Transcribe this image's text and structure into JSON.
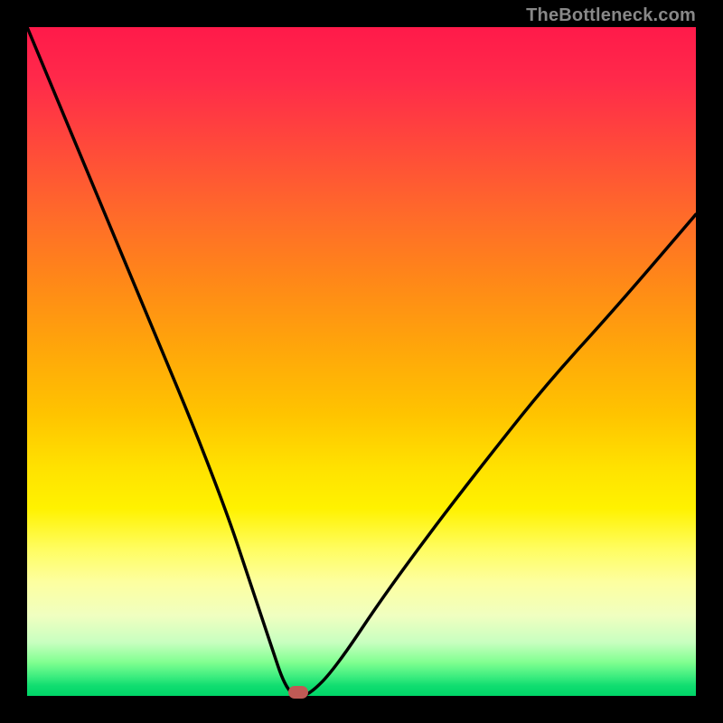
{
  "watermark": "TheBottleneck.com",
  "chart_data": {
    "type": "line",
    "title": "",
    "xlabel": "",
    "ylabel": "",
    "xlim": [
      0,
      100
    ],
    "ylim": [
      0,
      100
    ],
    "grid": false,
    "series": [
      {
        "name": "bottleneck-curve",
        "x": [
          0,
          5,
          10,
          15,
          20,
          25,
          30,
          33,
          35,
          37,
          38,
          39,
          40,
          41.5,
          43,
          45,
          48,
          52,
          57,
          63,
          70,
          78,
          88,
          100
        ],
        "y": [
          100,
          88,
          76,
          64,
          52,
          40,
          27,
          18,
          12,
          6,
          3,
          1,
          0,
          0,
          1,
          3,
          7,
          13,
          20,
          28,
          37,
          47,
          58,
          72
        ]
      }
    ],
    "marker": {
      "x_percent": 40.5,
      "y_percent": 0.5,
      "color": "#c05a55"
    },
    "background_gradient": {
      "stops": [
        {
          "pos": 0,
          "color": "#ff1a4a"
        },
        {
          "pos": 50,
          "color": "#ffc400"
        },
        {
          "pos": 80,
          "color": "#fffd60"
        },
        {
          "pos": 100,
          "color": "#00d568"
        }
      ]
    }
  }
}
